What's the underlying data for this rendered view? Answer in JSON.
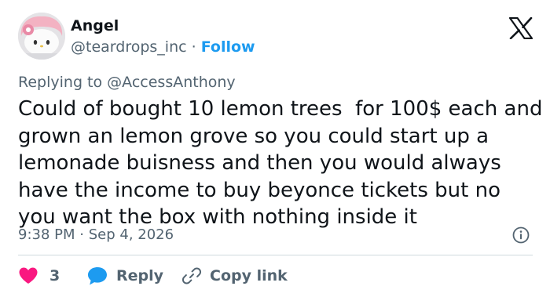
{
  "author": {
    "name": "Angel",
    "handle": "@teardrops_inc",
    "separator": "·",
    "follow_label": "Follow"
  },
  "platform_logo": "x-logo-icon",
  "replying_to": {
    "prefix": "Replying to",
    "mention": "@AccessAnthony"
  },
  "tweet": {
    "lines": [
      "Could of bought 10 lemon trees  for 100$ each and",
      "grown an lemon grove so you could start up a",
      "lemonade buisness and then you would always",
      "have the income to buy beyonce tickets but no",
      "you want the box with nothing inside it"
    ]
  },
  "meta": {
    "time": "9:38 PM",
    "separator": "·",
    "date": "Sep 4, 2026",
    "info_icon": "info-icon"
  },
  "actions": {
    "like_count": "3",
    "like_icon": "heart-icon",
    "reply_label": "Reply",
    "reply_icon": "speech-bubble-icon",
    "copy_label": "Copy link",
    "copy_icon": "link-icon"
  },
  "colors": {
    "text": "#0f1419",
    "secondary": "#536471",
    "accent": "#1d9bf0",
    "like": "#f91880",
    "divider": "#cfd9de"
  }
}
